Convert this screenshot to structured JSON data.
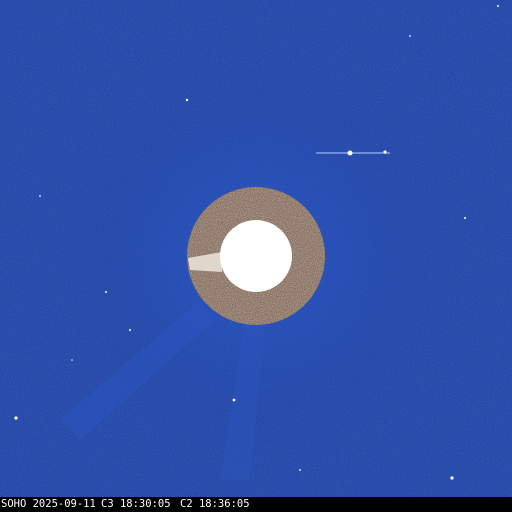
{
  "caption": {
    "mission_date": "SOHO 2025-09-11",
    "c3_time": "C3 18:30:05",
    "c2_time": "C2 18:36:05"
  },
  "colors": {
    "background_blue": "#1a3fa3",
    "occulter_ring": "#5a4030",
    "sun_disk": "#ffffff",
    "caption_bar": "#000000",
    "caption_text": "#ffffff"
  }
}
